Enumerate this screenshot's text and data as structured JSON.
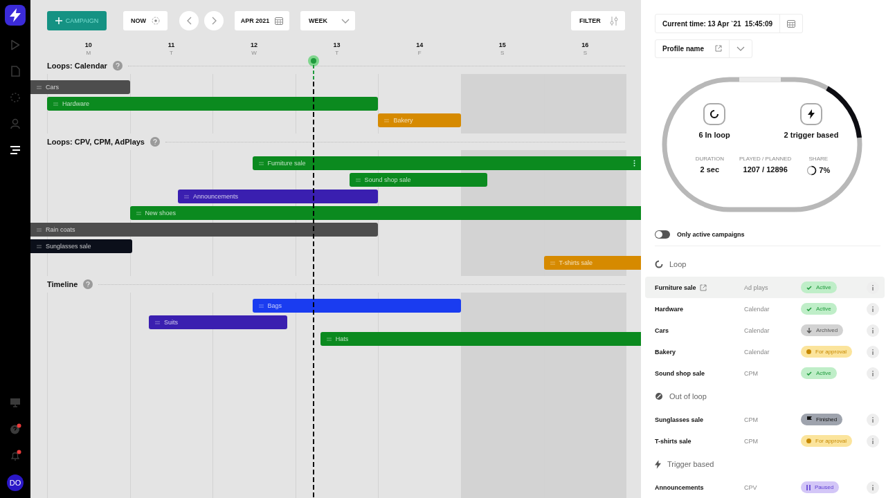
{
  "sidebar": {
    "nav": [
      {
        "kind": "play",
        "selected": false
      },
      {
        "kind": "file",
        "selected": false
      },
      {
        "kind": "dots",
        "selected": false
      },
      {
        "kind": "user",
        "selected": false
      },
      {
        "kind": "menu",
        "selected": true
      }
    ],
    "bottom": [
      {
        "kind": "monitor",
        "badge": false
      },
      {
        "kind": "help",
        "badge": true
      },
      {
        "kind": "bell",
        "badge": true
      }
    ],
    "avatar": "DO"
  },
  "toolbar": {
    "add_button": "CAMPAIGN",
    "now_button": "NOW",
    "month": "APR 2021",
    "view": "WEEK",
    "filter": "FILTER"
  },
  "days": [
    {
      "date": "10",
      "weekday": "M",
      "weekend": false
    },
    {
      "date": "11",
      "weekday": "T",
      "weekend": false
    },
    {
      "date": "12",
      "weekday": "W",
      "weekend": false
    },
    {
      "date": "13",
      "weekday": "T",
      "weekend": false
    },
    {
      "date": "14",
      "weekday": "F",
      "weekend": false
    },
    {
      "date": "15",
      "weekday": "S",
      "weekend": true
    },
    {
      "date": "16",
      "weekday": "S",
      "weekend": true
    }
  ],
  "sections": [
    {
      "title": "Loops: Calendar",
      "rows": [
        {
          "label": "Cars",
          "color": "#4d4d4d",
          "hovered": false
        },
        {
          "label": "Hardware",
          "color": "#0b8a1f",
          "hovered": false
        },
        {
          "label": "Bakery",
          "color": "#d68a00",
          "hovered": false
        }
      ]
    },
    {
      "title": "Loops: CPV, CPM, AdPlays",
      "rows": [
        {
          "label": "Furniture sale",
          "color": "#0b8a1f",
          "hovered": true
        },
        {
          "label": "Sound shop sale",
          "color": "#0b8a1f",
          "hovered": false
        },
        {
          "label": "Announcements",
          "color": "#3a1fb0",
          "hovered": false
        },
        {
          "label": "New shoes",
          "color": "#0b8a1f",
          "hovered": false
        },
        {
          "label": "Rain coats",
          "color": "#4d4d4d",
          "hovered": false
        },
        {
          "label": "Sunglasses sale",
          "color": "#0b0f1a",
          "hovered": false
        },
        {
          "label": "T-shirts sale",
          "color": "#d68a00",
          "hovered": false
        }
      ]
    },
    {
      "title": "Timeline",
      "rows": [
        {
          "label": "Bags",
          "color": "#1a3cf0",
          "hovered": false
        },
        {
          "label": "Suits",
          "color": "#3a1fb0",
          "hovered": false
        },
        {
          "label": "Hats",
          "color": "#0b8a1f",
          "hovered": false
        }
      ]
    }
  ],
  "panel": {
    "current_time": "Current time: 13 Apr `21  15:45:09",
    "profile": "Profile name",
    "in_loop": "6 In loop",
    "trigger": "2 trigger based",
    "stats": [
      {
        "label": "DURATION",
        "value": "2 sec",
        "kind": "plain"
      },
      {
        "label": "PLAYED / PLANNED",
        "value": "1207 / 12896",
        "kind": "plain"
      },
      {
        "label": "SHARE",
        "value": "7%",
        "kind": "share"
      }
    ],
    "only_active": {
      "label": "Only active campaigns",
      "on": false
    },
    "groups": [
      {
        "kind": "loop",
        "title": "Loop",
        "rows": [
          {
            "name": "Furniture sale",
            "type": "Ad plays",
            "status": "Active",
            "kind": "active",
            "selected": true,
            "link": true
          },
          {
            "name": "Hardware",
            "type": "Calendar",
            "status": "Active",
            "kind": "active",
            "selected": false,
            "link": false
          },
          {
            "name": "Cars",
            "type": "Calendar",
            "status": "Archived",
            "kind": "archived",
            "selected": false,
            "link": false
          },
          {
            "name": "Bakery",
            "type": "Calendar",
            "status": "For approval",
            "kind": "approval",
            "selected": false,
            "link": false
          },
          {
            "name": "Sound shop sale",
            "type": "CPM",
            "status": "Active",
            "kind": "active",
            "selected": false,
            "link": false
          }
        ]
      },
      {
        "kind": "out",
        "title": "Out of loop",
        "rows": [
          {
            "name": "Sunglasses sale",
            "type": "CPM",
            "status": "Finished",
            "kind": "finished",
            "selected": false,
            "link": false
          },
          {
            "name": "T-shirts sale",
            "type": "CPM",
            "status": "For approval",
            "kind": "approval",
            "selected": false,
            "link": false
          }
        ]
      },
      {
        "kind": "trigger",
        "title": "Trigger based",
        "rows": [
          {
            "name": "Announcements",
            "type": "CPV",
            "status": "Paused",
            "kind": "paused",
            "selected": false,
            "link": false
          }
        ]
      }
    ]
  }
}
